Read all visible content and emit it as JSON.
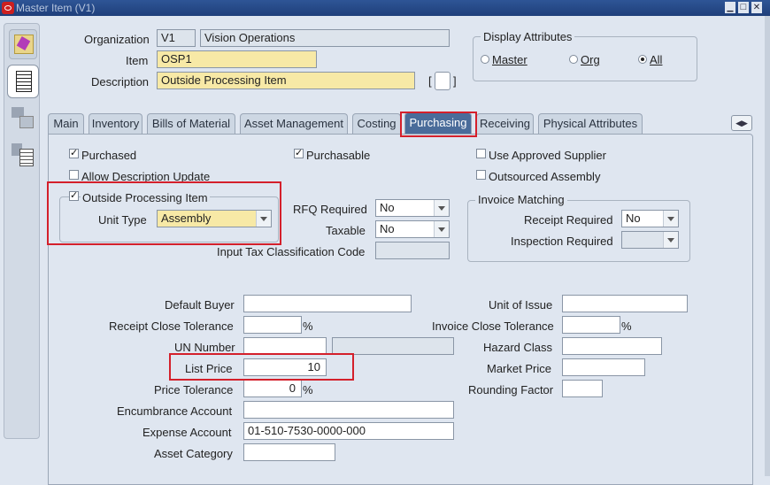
{
  "window": {
    "title": "Master Item (V1)",
    "min": "▁",
    "max": "□",
    "close": "✕"
  },
  "header": {
    "organization_label": "Organization",
    "org_code": "V1",
    "org_name": "Vision Operations",
    "item_label": "Item",
    "item_value": "OSP1",
    "description_label": "Description",
    "description_value": "Outside Processing Item",
    "bracket_open": "[",
    "bracket_close": "]"
  },
  "display_attributes": {
    "title": "Display Attributes",
    "options": [
      {
        "label": "Master",
        "selected": false
      },
      {
        "label": "Org",
        "selected": false
      },
      {
        "label": "All",
        "selected": true
      }
    ]
  },
  "tabs": [
    "Main",
    "Inventory",
    "Bills of Material",
    "Asset Management",
    "Costing",
    "Purchasing",
    "Receiving",
    "Physical Attributes"
  ],
  "active_tab": "Purchasing",
  "purchasing": {
    "purchased": {
      "label": "Purchased",
      "checked": true
    },
    "purchasable": {
      "label": "Purchasable",
      "checked": true
    },
    "use_approved_supplier": {
      "label": "Use Approved Supplier",
      "checked": false
    },
    "allow_description_update": {
      "label": "Allow Description Update",
      "checked": false
    },
    "outsourced_assembly": {
      "label": "Outsourced Assembly",
      "checked": false
    },
    "outside_processing_item": {
      "label": "Outside Processing Item",
      "checked": true
    },
    "unit_type": {
      "label": "Unit Type",
      "value": "Assembly"
    },
    "rfq_required": {
      "label": "RFQ Required",
      "value": "No"
    },
    "taxable": {
      "label": "Taxable",
      "value": "No"
    },
    "input_tax_classification_code": {
      "label": "Input Tax Classification Code",
      "value": ""
    },
    "invoice_matching": {
      "title": "Invoice Matching",
      "receipt_required": {
        "label": "Receipt Required",
        "value": "No"
      },
      "inspection_required": {
        "label": "Inspection Required",
        "value": ""
      }
    },
    "default_buyer": {
      "label": "Default Buyer",
      "value": ""
    },
    "receipt_close_tolerance": {
      "label": "Receipt Close Tolerance",
      "value": "",
      "unit": "%"
    },
    "un_number": {
      "label": "UN Number",
      "value": "",
      "desc": ""
    },
    "list_price": {
      "label": "List Price",
      "value": "10"
    },
    "price_tolerance": {
      "label": "Price Tolerance",
      "value": "0",
      "unit": "%"
    },
    "encumbrance_account": {
      "label": "Encumbrance Account",
      "value": ""
    },
    "expense_account": {
      "label": "Expense Account",
      "value": "01-510-7530-0000-000"
    },
    "asset_category": {
      "label": "Asset Category",
      "value": ""
    },
    "unit_of_issue": {
      "label": "Unit of Issue",
      "value": ""
    },
    "invoice_close_tolerance": {
      "label": "Invoice Close Tolerance",
      "value": "",
      "unit": "%"
    },
    "hazard_class": {
      "label": "Hazard Class",
      "value": ""
    },
    "market_price": {
      "label": "Market Price",
      "value": ""
    },
    "rounding_factor": {
      "label": "Rounding Factor",
      "value": ""
    }
  },
  "colors": {
    "title_bar": "#1f3f7a",
    "oracle_red": "#cc1f1f",
    "highlight": "#d4202b",
    "required_field": "#f7e9a6",
    "active_tab": "#4a6c9a"
  }
}
